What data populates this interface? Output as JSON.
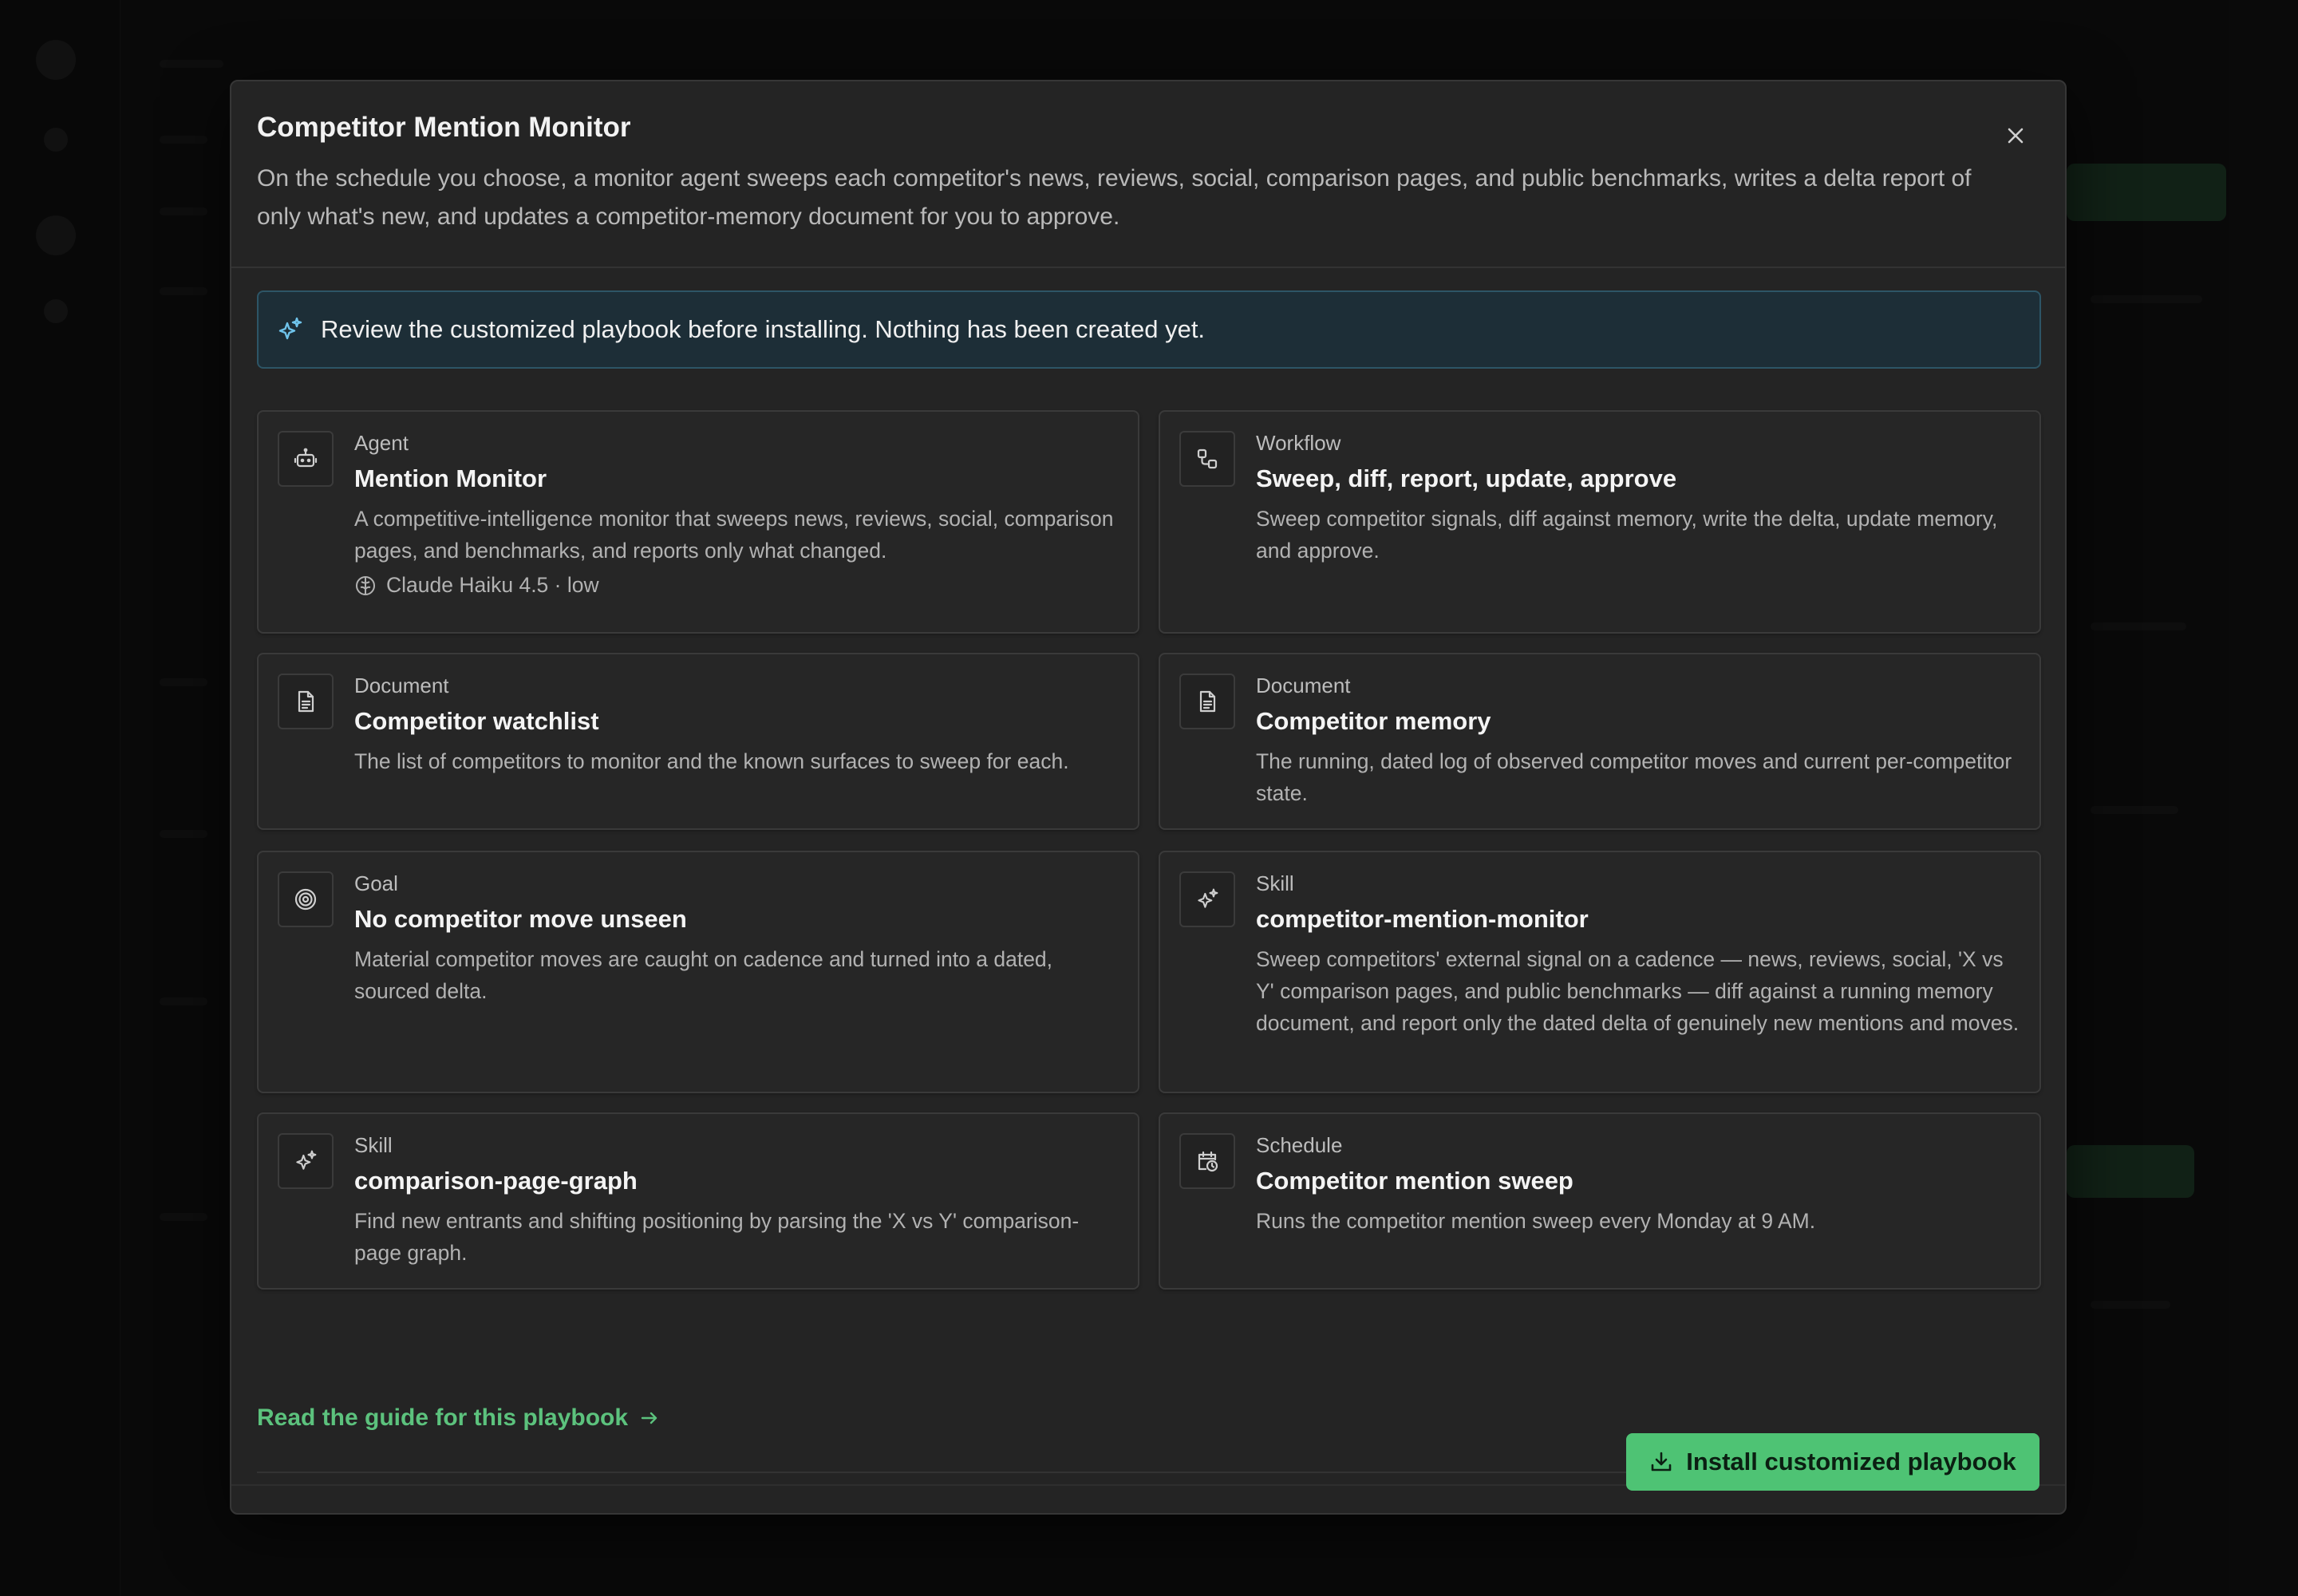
{
  "modal": {
    "title": "Competitor Mention Monitor",
    "description": "On the schedule you choose, a monitor agent sweeps each competitor's news, reviews, social, comparison pages, and public benchmarks, writes a delta report of only what's new, and updates a competitor-memory document for you to approve.",
    "close_icon": "close-icon"
  },
  "banner": {
    "icon": "sparkles-icon",
    "text": "Review the customized playbook before installing. Nothing has been created yet."
  },
  "cards": [
    {
      "icon": "robot-icon",
      "type": "Agent",
      "title": "Mention Monitor",
      "description": "A competitive-intelligence monitor that sweeps news, reviews, social, comparison pages, and benchmarks, and reports only what changed.",
      "model": "Claude Haiku 4.5 · low"
    },
    {
      "icon": "workflow-icon",
      "type": "Workflow",
      "title": "Sweep, diff, report, update, approve",
      "description": "Sweep competitor signals, diff against memory, write the delta, update memory, and approve."
    },
    {
      "icon": "document-icon",
      "type": "Document",
      "title": "Competitor watchlist",
      "description": "The list of competitors to monitor and the known surfaces to sweep for each."
    },
    {
      "icon": "document-icon",
      "type": "Document",
      "title": "Competitor memory",
      "description": "The running, dated log of observed competitor moves and current per-competitor state."
    },
    {
      "icon": "target-icon",
      "type": "Goal",
      "title": "No competitor move unseen",
      "description": "Material competitor moves are caught on cadence and turned into a dated, sourced delta."
    },
    {
      "icon": "sparkles-icon",
      "type": "Skill",
      "title": "competitor-mention-monitor",
      "description": "Sweep competitors' external signal on a cadence — news, reviews, social, 'X vs Y' comparison pages, and public benchmarks — diff against a running memory document, and report only the dated delta of genuinely new mentions and moves."
    },
    {
      "icon": "sparkles-icon",
      "type": "Skill",
      "title": "comparison-page-graph",
      "description": "Find new entrants and shifting positioning by parsing the 'X vs Y' comparison-page graph."
    },
    {
      "icon": "calendar-clock-icon",
      "type": "Schedule",
      "title": "Competitor mention sweep",
      "description": "Runs the competitor mention sweep every Monday at 9 AM."
    }
  ],
  "guide_link": "Read the guide for this playbook",
  "install_button": "Install customized playbook",
  "colors": {
    "accent": "#4ec374",
    "link": "#5cc27d",
    "banner_bg": "#1d2e37",
    "banner_border": "#2d5566",
    "modal_bg": "#242424"
  }
}
